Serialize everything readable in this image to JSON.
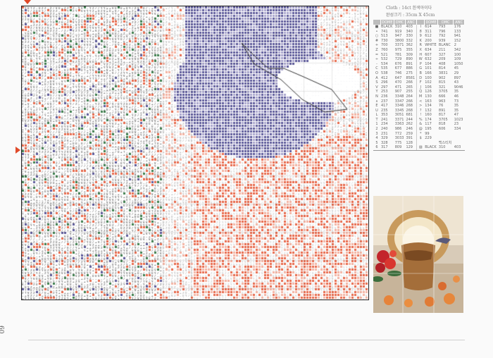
{
  "header": {
    "cloth": "Cloth : 14ct 흰색아이다",
    "size": "완성크기 : 35cm X 45cm"
  },
  "page_number": "60",
  "key": {
    "columns": [
      "DOME",
      "DMC",
      "ANC"
    ],
    "left_rows": [
      {
        "sym": "■",
        "dome": "BLACK",
        "dmc": "310",
        "anc": "403"
      },
      {
        "sym": "•",
        "dome": "741",
        "dmc": "919",
        "anc": "340"
      },
      {
        "sym": "○",
        "dome": "513",
        "dmc": "947",
        "anc": "330"
      },
      {
        "sym": "#",
        "dome": "730",
        "dmc": "3800",
        "anc": "332"
      },
      {
        "sym": "+",
        "dome": "700",
        "dmc": "3371",
        "anc": "362"
      },
      {
        "sym": "Z",
        "dome": "760",
        "dmc": "975",
        "anc": "355"
      },
      {
        "sym": "=",
        "dome": "521",
        "dmc": "781",
        "anc": "309"
      },
      {
        "sym": "÷",
        "dome": "532",
        "dmc": "729",
        "anc": "890"
      },
      {
        "sym": "-",
        "dome": "534",
        "dmc": "676",
        "anc": "891"
      },
      {
        "sym": "C",
        "dome": "535",
        "dmc": "677",
        "anc": "886"
      },
      {
        "sym": "O",
        "dome": "538",
        "dmc": "746",
        "anc": "275"
      },
      {
        "sym": "A",
        "dome": "412",
        "dmc": "647",
        "anc": "8581"
      },
      {
        "sym": "S",
        "dome": "296",
        "dmc": "470",
        "anc": "266"
      },
      {
        "sym": "V",
        "dome": "297",
        "dmc": "471",
        "anc": "265"
      },
      {
        "sym": "Y",
        "dome": "253",
        "dmc": "907",
        "anc": "255"
      },
      {
        "sym": "N",
        "dome": "236",
        "dmc": "3348",
        "anc": "264"
      },
      {
        "sym": "∧",
        "dome": "237",
        "dmc": "3347",
        "anc": "266"
      },
      {
        "sym": "E",
        "dome": "417",
        "dmc": "3346",
        "anc": "268"
      },
      {
        "sym": "U",
        "dome": "235",
        "dmc": "3345",
        "anc": "268"
      },
      {
        "sym": "L",
        "dome": "353",
        "dmc": "3051",
        "anc": "681"
      },
      {
        "sym": "T",
        "dome": "241",
        "dmc": "3371",
        "anc": "244"
      },
      {
        "sym": "1",
        "dome": "234",
        "dmc": "3363",
        "anc": "262"
      },
      {
        "sym": "2",
        "dome": "240",
        "dmc": "986",
        "anc": "246"
      },
      {
        "sym": "3",
        "dome": "231",
        "dmc": "772",
        "anc": "259"
      },
      {
        "sym": "4",
        "dome": "329",
        "dmc": "3033",
        "anc": "391"
      },
      {
        "sym": "5",
        "dome": "328",
        "dmc": "775",
        "anc": "128"
      },
      {
        "sym": "6",
        "dome": "317",
        "dmc": "809",
        "anc": "129"
      }
    ],
    "right_rows": [
      {
        "sym": "I",
        "dome": "614",
        "dmc": "793",
        "anc": "176"
      },
      {
        "sym": "8",
        "dome": "311",
        "dmc": "796",
        "anc": "133"
      },
      {
        "sym": "9",
        "dome": "612",
        "dmc": "792",
        "anc": "941"
      },
      {
        "sym": "K",
        "dome": "200",
        "dmc": "939",
        "anc": "152"
      },
      {
        "sym": "R",
        "dome": "WHITE",
        "dmc": "BLANC",
        "anc": "2"
      },
      {
        "sym": "X",
        "dome": "634",
        "dmc": "211",
        "anc": "342"
      },
      {
        "sym": "H",
        "dome": "607",
        "dmc": "327",
        "anc": "100"
      },
      {
        "sym": "W",
        "dome": "632",
        "dmc": "209",
        "anc": "109"
      },
      {
        "sym": "P",
        "dome": "104",
        "dmc": "408",
        "anc": "1050"
      },
      {
        "sym": "G",
        "dome": "101",
        "dmc": "814",
        "anc": "45"
      },
      {
        "sym": "B",
        "dome": "166",
        "dmc": "3831",
        "anc": "29"
      },
      {
        "sym": "D",
        "dome": "100",
        "dmc": "902",
        "anc": "897"
      },
      {
        "sym": "F",
        "dome": "102",
        "dmc": "815",
        "anc": "43"
      },
      {
        "sym": "J",
        "dome": "106",
        "dmc": "321",
        "anc": "9046"
      },
      {
        "sym": "Q",
        "dome": "126",
        "dmc": "3705",
        "anc": "35"
      },
      {
        "sym": "M",
        "dome": "130",
        "dmc": "666",
        "anc": "46"
      },
      {
        "sym": "<",
        "dome": "163",
        "dmc": "963",
        "anc": "73"
      },
      {
        "sym": ">",
        "dome": "134",
        "dmc": "76",
        "anc": "35"
      },
      {
        "sym": "?",
        "dome": "132",
        "dmc": "891",
        "anc": "35"
      },
      {
        "sym": "!",
        "dome": "160",
        "dmc": "817",
        "anc": "47"
      },
      {
        "sym": "%",
        "dome": "174",
        "dmc": "3705",
        "anc": "1023"
      },
      {
        "sym": "&",
        "dome": "117",
        "dmc": "818",
        "anc": "23"
      },
      {
        "sym": "@",
        "dome": "195",
        "dmc": "606",
        "anc": "334"
      },
      {
        "sym": "*",
        "dome": "99",
        "dmc": "",
        "anc": ""
      },
      {
        "sym": "$",
        "dome": "229",
        "dmc": "",
        "anc": ""
      },
      {
        "sym": "",
        "dome": "",
        "dmc": "백스티치",
        "anc": ""
      },
      {
        "sym": "▨",
        "dome": "BLACK",
        "dmc": "310",
        "anc": "403"
      }
    ]
  },
  "colors": {
    "salmon": "#e86a4c",
    "pink": "#f3b3a2",
    "purple": "#5d5a9a",
    "lavender": "#a8a4cc",
    "green": "#3e7f4e",
    "symbol": "#333333"
  }
}
